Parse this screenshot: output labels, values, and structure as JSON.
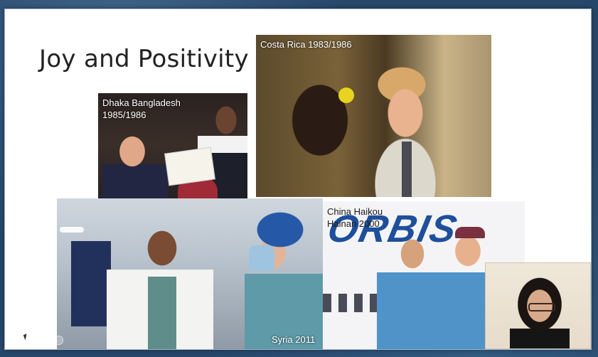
{
  "slide": {
    "title": "Joy and Positivity"
  },
  "photos": {
    "costa_rica": {
      "caption": "Costa Rica 1983/1986"
    },
    "dhaka": {
      "caption_line1": "Dhaka Bangladesh",
      "caption_line2": "1985/1986"
    },
    "syria": {
      "caption": "Syria 2011"
    },
    "china": {
      "caption_line1": "China Haikou",
      "caption_line2": "Hainan 2000",
      "aircraft_text": "ORBIS"
    }
  },
  "controls": {
    "icons": [
      "prev-icon",
      "next-icon",
      "pen-icon",
      "zoom-icon",
      "more-icon"
    ],
    "glyphs": [
      "‹",
      "›",
      "✎",
      "⊕",
      "…"
    ]
  },
  "colors": {
    "background": "#27476a",
    "slide": "#ffffff",
    "orbis_blue": "#1e4f9c"
  }
}
